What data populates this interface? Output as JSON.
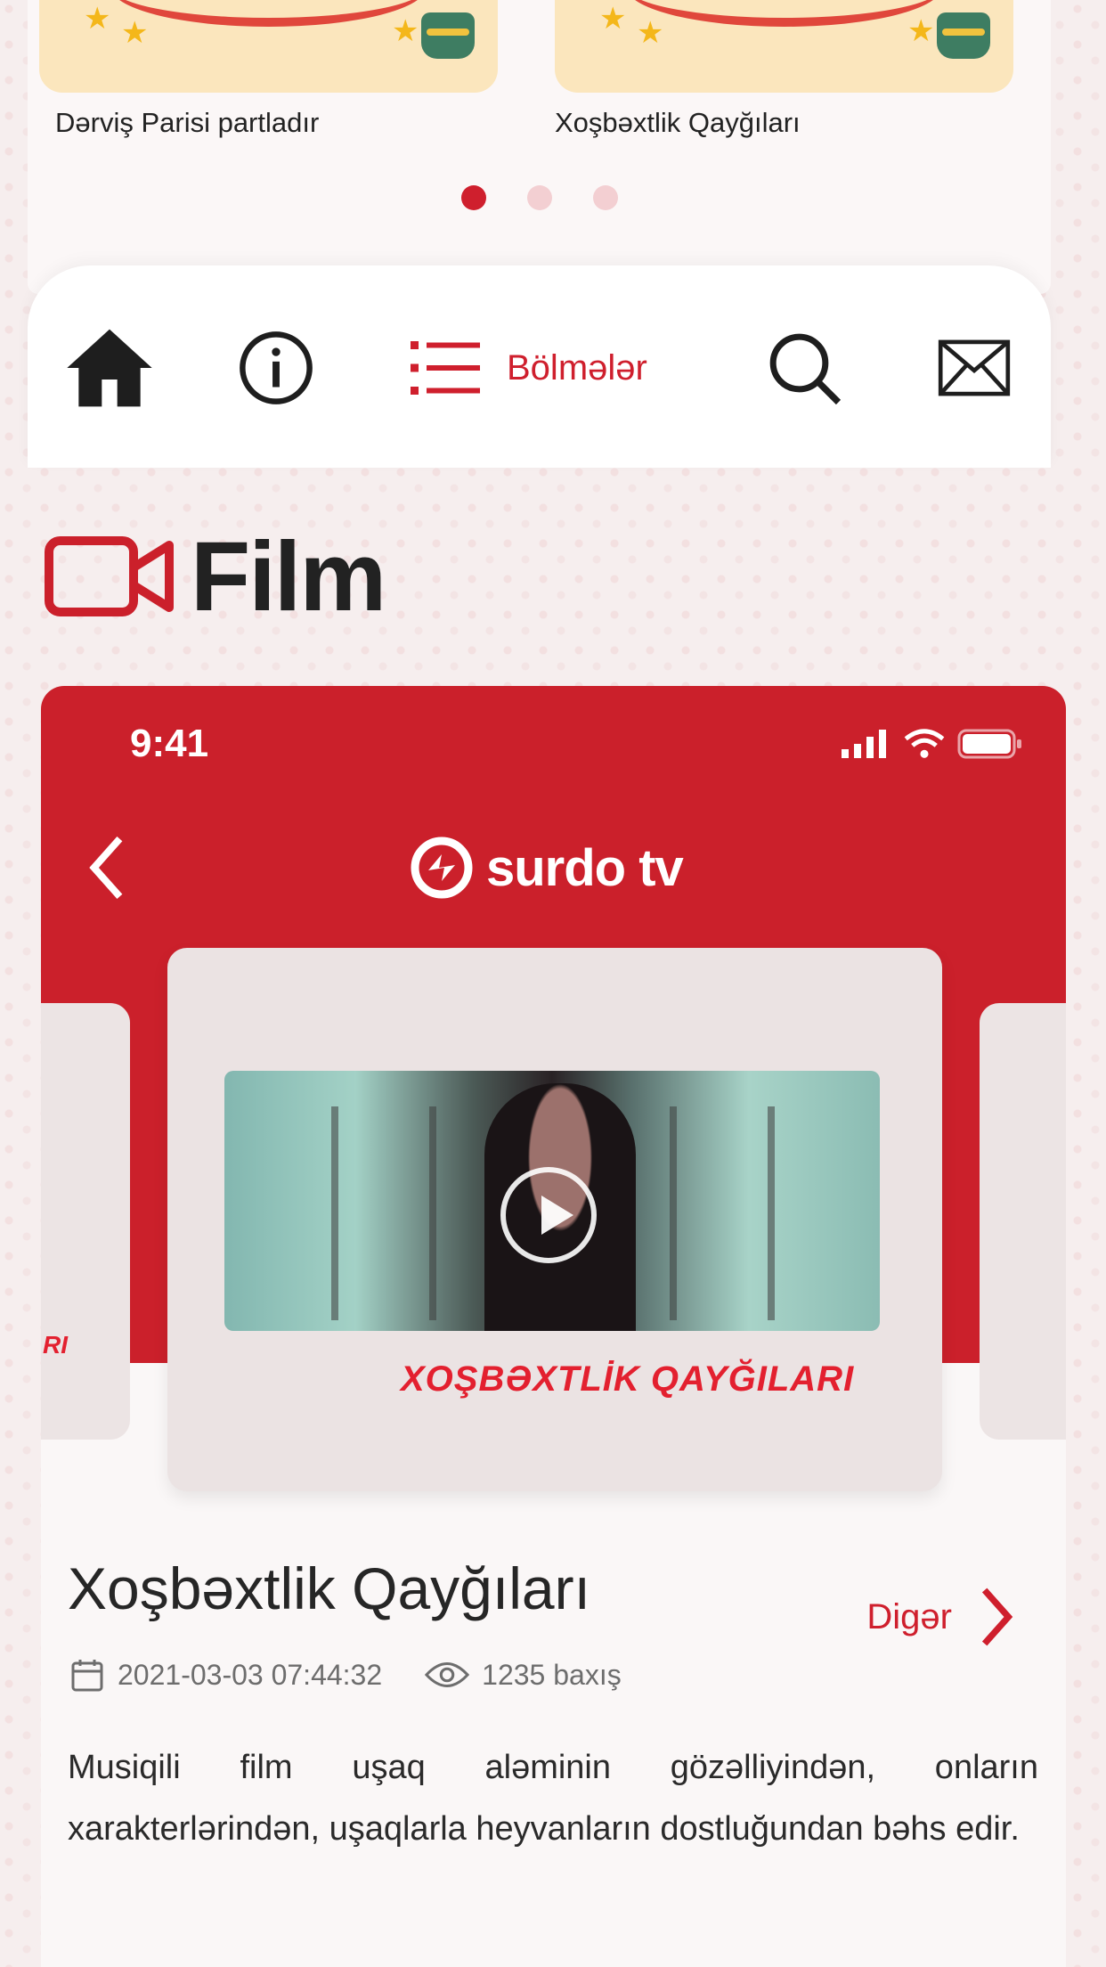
{
  "carousel": {
    "items": [
      {
        "title": "Dərviş Parisi partladır"
      },
      {
        "title": "Xoşbəxtlik Qayğıları"
      }
    ],
    "pages": 3,
    "active_page": 1
  },
  "nav": {
    "items": [
      {
        "icon": "home-icon"
      },
      {
        "icon": "info-icon"
      },
      {
        "icon": "list-icon",
        "label": "Bölmələr"
      },
      {
        "icon": "search-icon"
      },
      {
        "icon": "mail-icon"
      }
    ]
  },
  "section": {
    "icon": "video-camera-icon",
    "title": "Film"
  },
  "phone": {
    "status_time": "9:41",
    "logo_text": "surdo tv",
    "card_caption": "XOŞBƏXTLİK QAYĞILARI",
    "side_caption": "RI",
    "episode_title": "Xoşbəxtlik Qayğıları",
    "more_label": "Digər",
    "date": "2021-03-03 07:44:32",
    "views": "1235 baxış",
    "description": "Musiqili film uşaq aləminin gözəlliyindən, onların xarakterlərindən, uşaqlarla heyvanların dostluğundan bəhs edir."
  },
  "colors": {
    "accent": "#cb202b",
    "text": "#222222",
    "muted": "#6d6d6d"
  }
}
